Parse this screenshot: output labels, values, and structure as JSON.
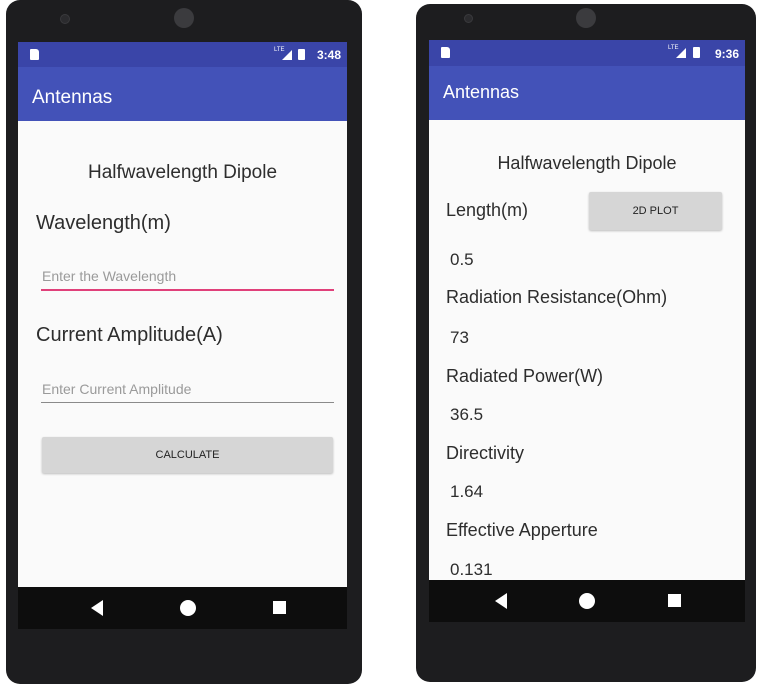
{
  "left_screen": {
    "status_time": "3:48",
    "app_title": "Antennas",
    "heading": "Halfwavelength Dipole",
    "wavelength_label": "Wavelength(m)",
    "wavelength_placeholder": "Enter the Wavelength",
    "current_label": "Current Amplitude(A)",
    "current_placeholder": "Enter Current Amplitude",
    "calculate_label": "CALCULATE"
  },
  "right_screen": {
    "status_time": "9:36",
    "app_title": "Antennas",
    "heading": "Halfwavelength Dipole",
    "length_label": "Length(m)",
    "plot_button": "2D PLOT",
    "length_value": "0.5",
    "resistance_label": "Radiation Resistance(Ohm)",
    "resistance_value": "73",
    "power_label": "Radiated Power(W)",
    "power_value": "36.5",
    "directivity_label": "Directivity",
    "directivity_value": "1.64",
    "aperture_label": "Effective Apperture",
    "aperture_value": "0.131"
  },
  "status_icons": [
    "sd-card-icon",
    "lte-signal-icon",
    "battery-icon"
  ],
  "nav_icons": [
    "back-icon",
    "home-icon",
    "recents-icon"
  ],
  "colors": {
    "app_bar": "#4352b8",
    "status_bar": "#3a45a8",
    "focused_underline": "#e0407a",
    "screen_background": "#fafafa"
  }
}
